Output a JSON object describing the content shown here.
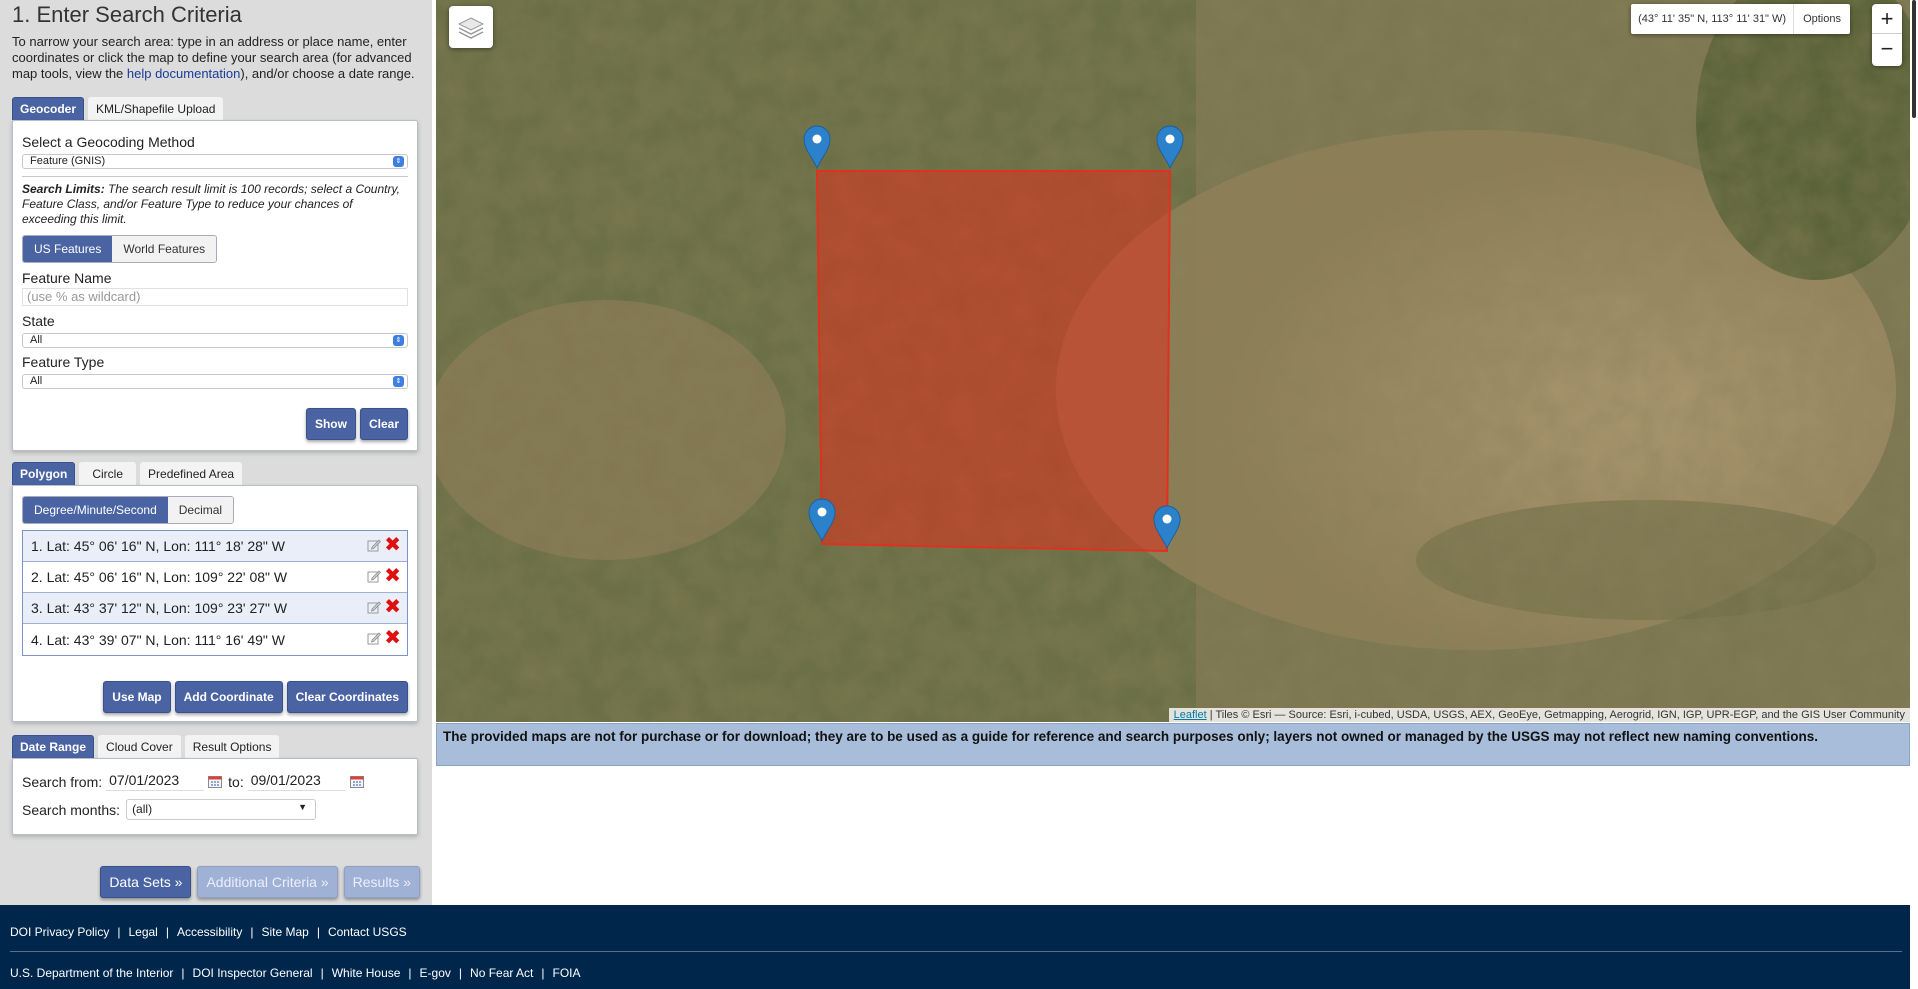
{
  "left": {
    "title": "1. Enter Search Criteria",
    "intro_before_link": "To narrow your search area: type in an address or place name, enter coordinates or click the map to define your search area (for advanced map tools, view the ",
    "intro_link": "help documentation",
    "intro_after_link": "), and/or choose a date range.",
    "top_tabs": [
      "Geocoder",
      "KML/Shapefile Upload"
    ],
    "geocoder": {
      "method_label": "Select a Geocoding Method",
      "method_value": "Feature (GNIS)",
      "limits_bold": "Search Limits:",
      "limits_text": " The search result limit is 100 records; select a Country, Feature Class, and/or Feature Type to reduce your chances of exceeding this limit.",
      "scope": [
        "US Features",
        "World Features"
      ],
      "feature_name_label": "Feature Name",
      "feature_name_placeholder": "(use % as wildcard)",
      "state_label": "State",
      "state_value": "All",
      "feature_type_label": "Feature Type",
      "feature_type_value": "All",
      "show_button": "Show",
      "clear_button": "Clear"
    },
    "area_tabs": [
      "Polygon",
      "Circle",
      "Predefined Area"
    ],
    "polygon": {
      "format": [
        "Degree/Minute/Second",
        "Decimal"
      ],
      "coordinates": [
        "1.  Lat: 45° 06' 16\" N, Lon: 111° 18' 28\" W",
        "2.  Lat: 45° 06' 16\" N, Lon: 109° 22' 08\" W",
        "3.  Lat: 43° 37' 12\" N, Lon: 109° 23' 27\" W",
        "4.  Lat: 43° 39' 07\" N, Lon: 111° 16' 49\" W"
      ],
      "use_map_button": "Use Map",
      "add_coordinate_button": "Add Coordinate",
      "clear_coordinates_button": "Clear Coordinates"
    },
    "date_tabs": [
      "Date Range",
      "Cloud Cover",
      "Result Options"
    ],
    "date": {
      "from_label": "Search from:",
      "from_value": "07/01/2023",
      "to_label": "to:",
      "to_value": "09/01/2023",
      "months_label": "Search months:",
      "months_value": "(all)"
    },
    "nav_buttons": [
      "Data Sets »",
      "Additional Criteria »",
      "Results »"
    ]
  },
  "map": {
    "cursor_coords": "(43° 11' 35\" N, 113° 11' 31\" W)",
    "options_label": "Options",
    "zoom_in": "+",
    "zoom_out": "−",
    "attribution_link": "Leaflet",
    "attribution_text": " | Tiles © Esri — Source: Esri, i-cubed, USDA, USGS, AEX, GeoEye, Getmapping, Aerogrid, IGN, IGP, UPR-EGP, and the GIS User Community",
    "polygon_color": "#e0301e",
    "marker_color": "#2b82cb",
    "disclaimer": "The provided maps are not for purchase or for download; they are to be used as a guide for reference and search purposes only; layers not owned or managed by the USGS may not reflect new naming conventions."
  },
  "footer": {
    "row1": [
      "DOI Privacy Policy",
      "Legal",
      "Accessibility",
      "Site Map",
      "Contact USGS"
    ],
    "row2": [
      "U.S. Department of the Interior",
      "DOI Inspector General",
      "White House",
      "E-gov",
      "No Fear Act",
      "FOIA"
    ]
  }
}
